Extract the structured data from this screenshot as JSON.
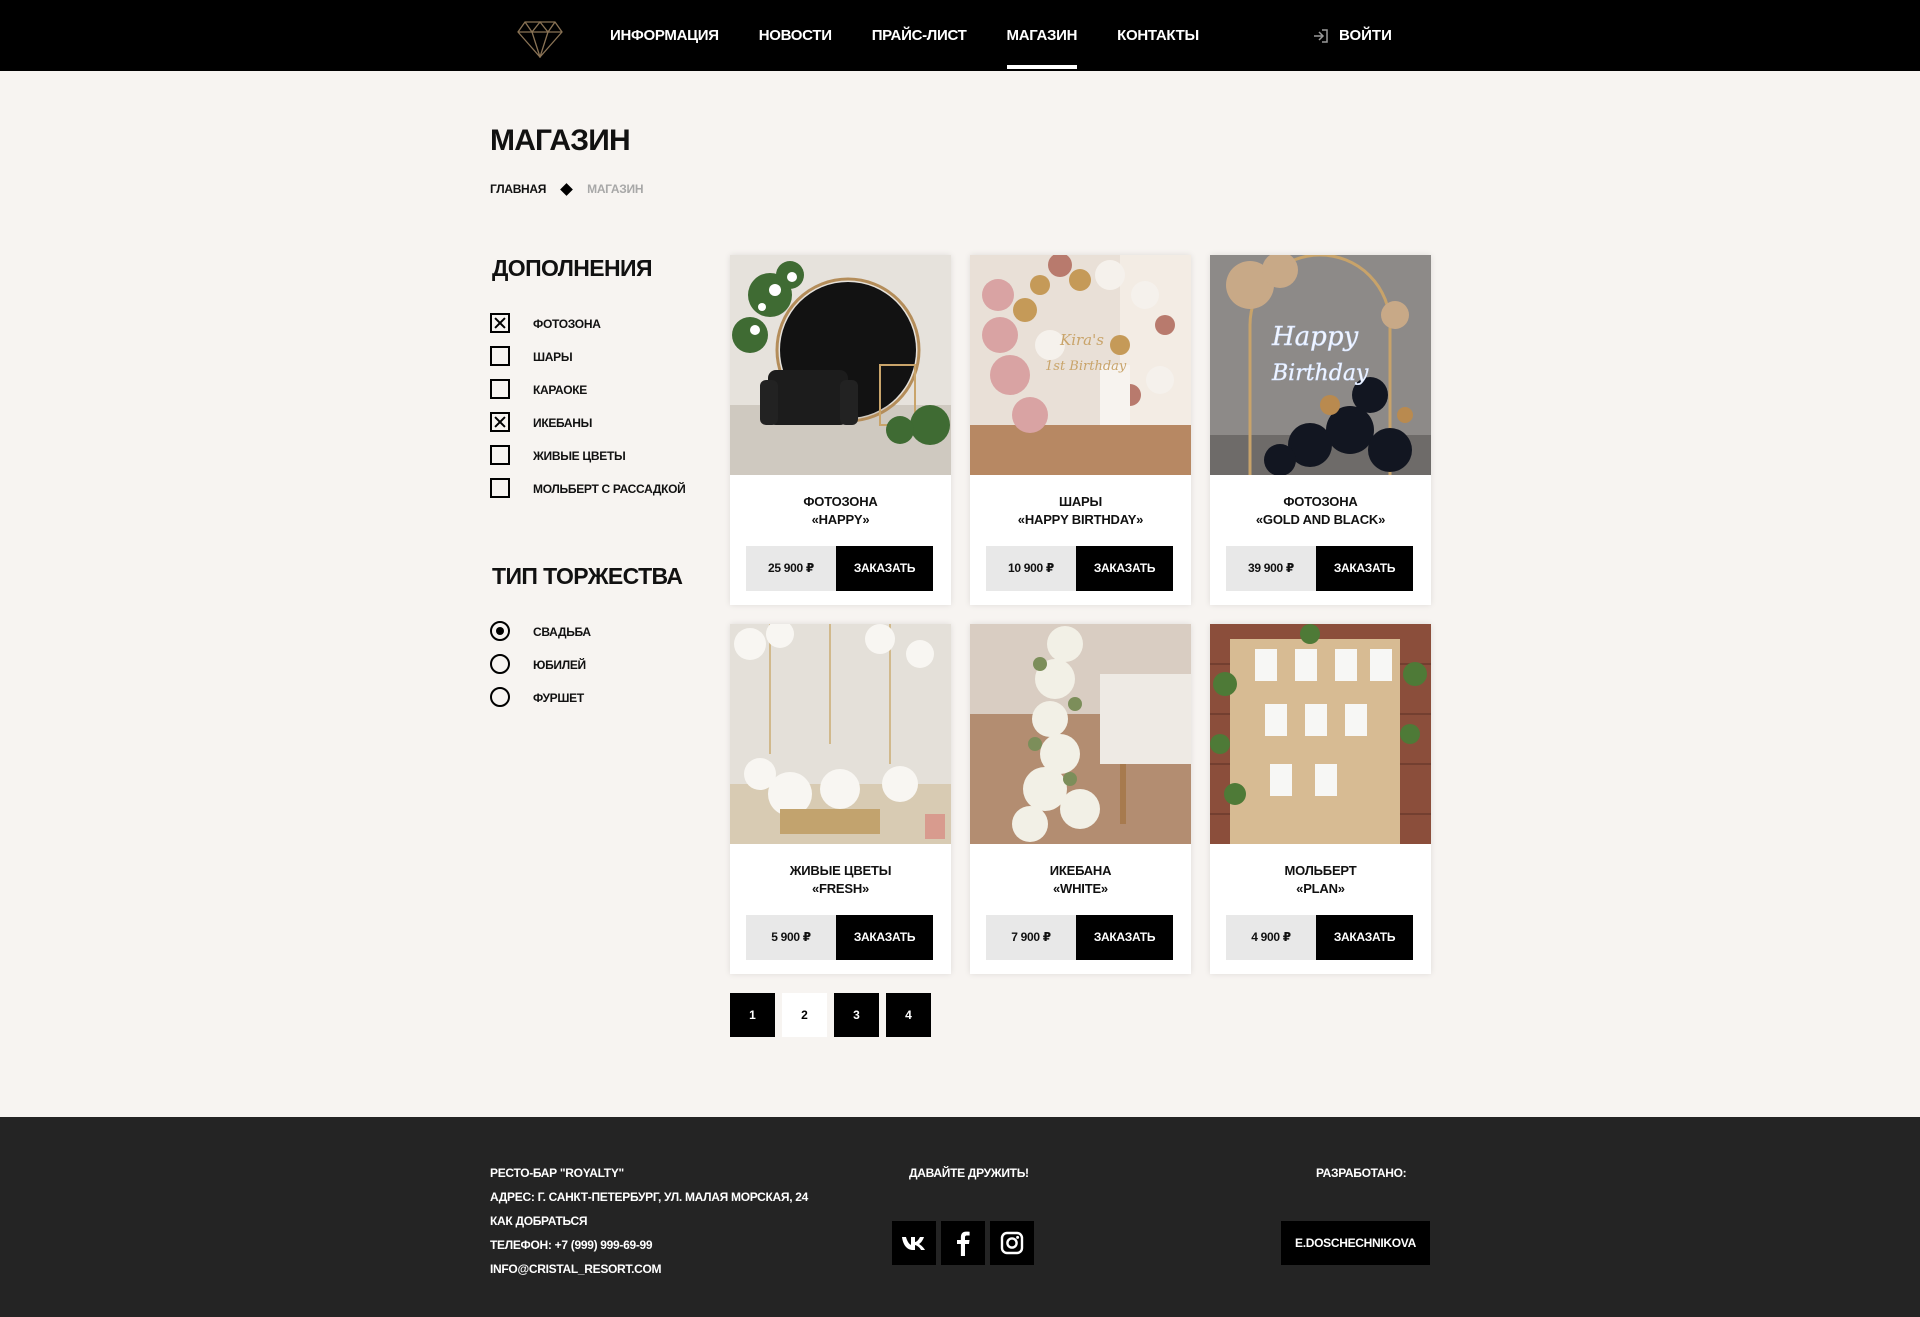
{
  "nav": {
    "items": [
      {
        "label": "ИНФОРМАЦИЯ",
        "active": false
      },
      {
        "label": "НОВОСТИ",
        "active": false
      },
      {
        "label": "ПРАЙС-ЛИСТ",
        "active": false
      },
      {
        "label": "МАГАЗИН",
        "active": true
      },
      {
        "label": "КОНТАКТЫ",
        "active": false
      }
    ],
    "login_label": "ВОЙТИ",
    "logo_icon": "diamond-icon"
  },
  "page": {
    "title": "МАГАЗИН",
    "breadcrumb": {
      "home": "ГЛАВНАЯ",
      "current": "МАГАЗИН"
    }
  },
  "sidebar": {
    "addons_title": "ДОПОЛНЕНИЯ",
    "addons": [
      {
        "label": "ФОТОЗОНА",
        "checked": true
      },
      {
        "label": "ШАРЫ",
        "checked": false
      },
      {
        "label": "КАРАОКЕ",
        "checked": false
      },
      {
        "label": "ИКЕБАНЫ",
        "checked": true
      },
      {
        "label": "ЖИВЫЕ ЦВЕТЫ",
        "checked": false
      },
      {
        "label": "МОЛЬБЕРТ С РАССАДКОЙ",
        "checked": false
      }
    ],
    "event_title": "ТИП ТОРЖЕСТВА",
    "events": [
      {
        "label": "СВАДЬБА",
        "checked": true
      },
      {
        "label": "ЮБИЛЕЙ",
        "checked": false
      },
      {
        "label": "ФУРШЕТ",
        "checked": false
      }
    ]
  },
  "products": [
    {
      "line1": "ФОТОЗОНА",
      "line2": "«HAPPY»",
      "price": "25 900 ₽",
      "button": "ЗАКАЗАТЬ",
      "image": "photo-zone-black-velvet"
    },
    {
      "line1": "ШАРЫ",
      "line2": "«HAPPY BIRTHDAY»",
      "price": "10 900 ₽",
      "button": "ЗАКАЗАТЬ",
      "image": "balloon-arch-pink-gold"
    },
    {
      "line1": "ФОТОЗОНА",
      "line2": "«GOLD AND BLACK»",
      "price": "39 900 ₽",
      "button": "ЗАКАЗАТЬ",
      "image": "neon-happy-birthday-black-balloons"
    },
    {
      "line1": "ЖИВЫЕ ЦВЕТЫ",
      "line2": "«FRESH»",
      "price": "5 900 ₽",
      "button": "ЗАКАЗАТЬ",
      "image": "white-flowers-table-decor"
    },
    {
      "line1": "ИКЕБАНА",
      "line2": "«WHITE»",
      "price": "7 900 ₽",
      "button": "ЗАКАЗАТЬ",
      "image": "white-hydrangea-garland"
    },
    {
      "line1": "МОЛЬБЕРТ",
      "line2": "«PLAN»",
      "price": "4 900 ₽",
      "button": "ЗАКАЗАТЬ",
      "image": "seating-plan-wooden-board"
    }
  ],
  "pagination": {
    "pages": [
      "1",
      "2",
      "3",
      "4"
    ],
    "current": "2"
  },
  "footer": {
    "info": [
      "РЕСТО-БАР \"ROYALTY\"",
      "АДРЕС: Г. САНКТ-ПЕТЕРБУРГ, УЛ. МАЛАЯ МОРСКАЯ, 24",
      "КАК ДОБРАТЬСЯ",
      "ТЕЛЕФОН: +7 (999) 999-69-99",
      "INFO@CRISTAL_RESORT.COM"
    ],
    "friends_title": "ДАВАЙТЕ ДРУЖИТЬ!",
    "socials": [
      "vk-icon",
      "facebook-icon",
      "instagram-icon"
    ],
    "dev_title": "РАЗРАБОТАНО:",
    "dev_name": "E.DOSCHECHNIKOVA"
  },
  "colors": {
    "page_bg": "#f7f4f1",
    "header_bg": "#000000",
    "footer_bg": "#242424",
    "price_bg": "#e8e8e8",
    "breadcrumb_current": "#a8a8a8"
  }
}
